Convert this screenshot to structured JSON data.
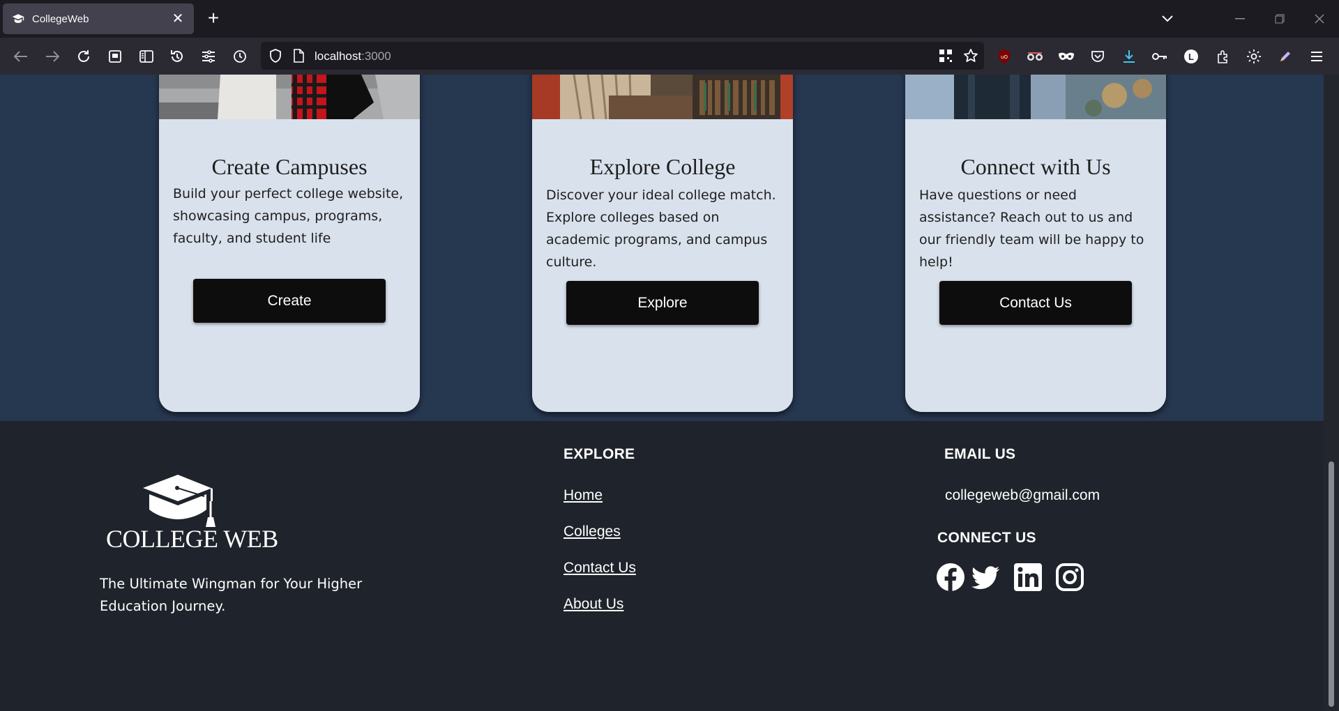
{
  "browser": {
    "tab_title": "CollegeWeb",
    "url_host": "localhost",
    "url_port": ":3000"
  },
  "cards": [
    {
      "title": "Create Campuses",
      "text": "Build your perfect college website, showcasing campus, programs, faculty, and student life",
      "button": "Create"
    },
    {
      "title": "Explore College",
      "text": "Discover your ideal college match. Explore colleges based on academic programs, and campus culture.",
      "button": "Explore"
    },
    {
      "title": "Connect with Us",
      "text": "Have questions or need assistance? Reach out to us and our friendly team will be happy to help!",
      "button": "Contact Us"
    }
  ],
  "footer": {
    "logo_text": "COLLEGE WEB",
    "tagline": "The Ultimate Wingman for Your Higher Education Journey.",
    "explore_heading": "EXPLORE",
    "links": [
      "Home",
      "Colleges",
      "Contact Us",
      "About Us"
    ],
    "email_heading": "EMAIL US",
    "email": "collegeweb@gmail.com",
    "connect_heading": "CONNECT US",
    "socials": [
      "facebook-icon",
      "twitter-icon",
      "linkedin-icon",
      "instagram-icon"
    ]
  }
}
